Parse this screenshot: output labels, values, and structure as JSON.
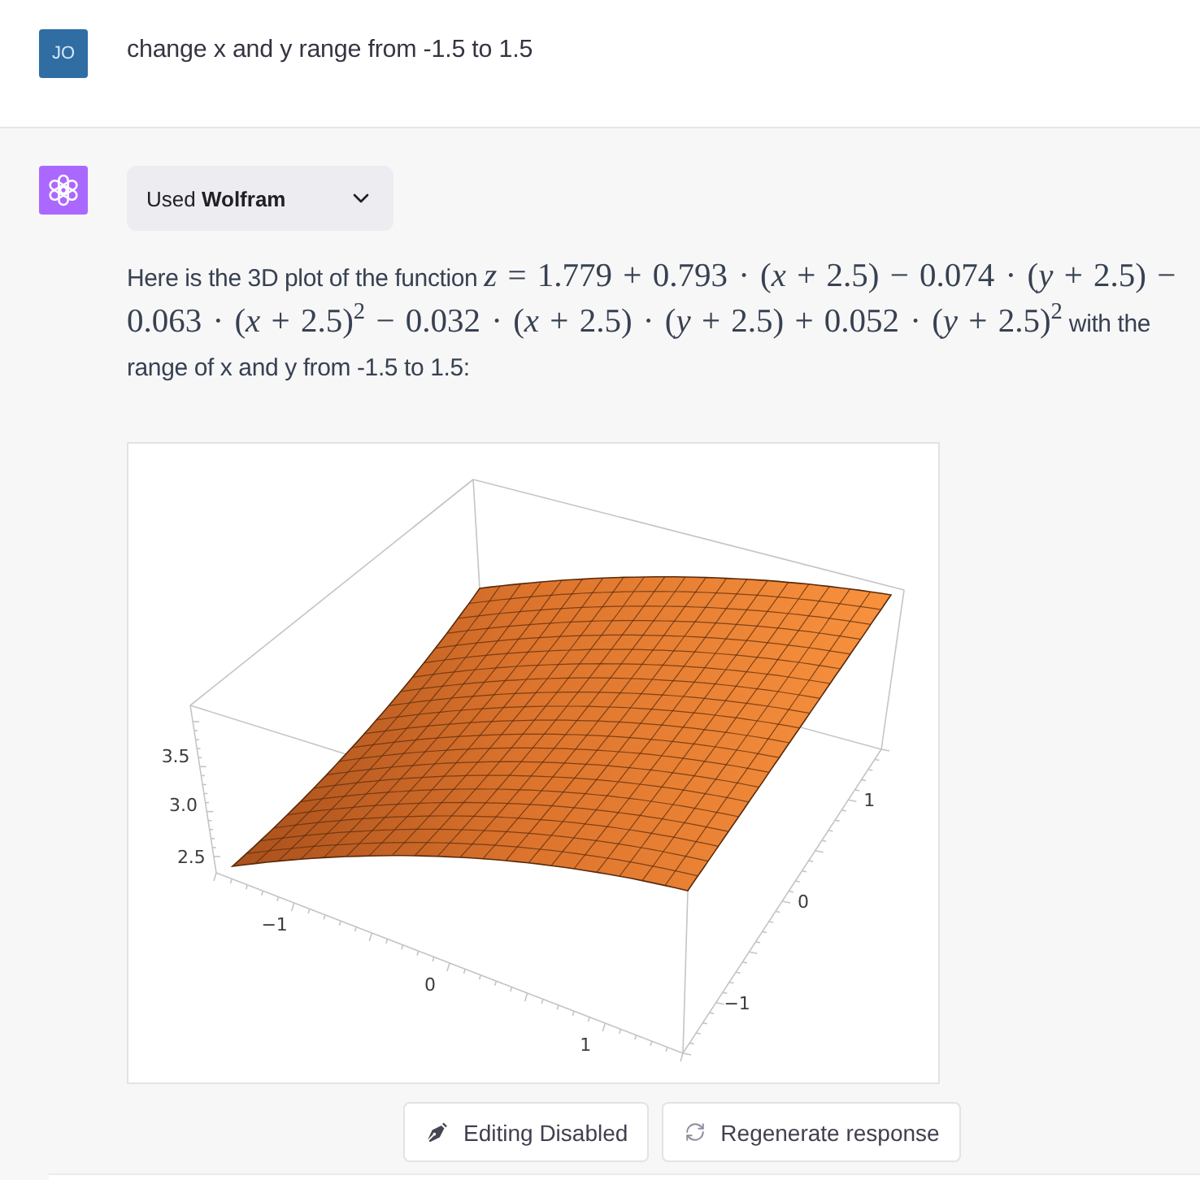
{
  "user_message": {
    "avatar": "JO",
    "text": "change x and y range from -1.5 to 1.5"
  },
  "assistant_message": {
    "plugin": {
      "label": "Used **Wolfram**",
      "expanded": false
    },
    "paragraph": [
      {
        "kind": "text",
        "text": "Here is the 3D plot of the function "
      },
      {
        "kind": "math",
        "text": "*z* = 1.779 + 0.793 · (*x* + 2.5) − 0.074 · (*y* + 2.5) − 0.063 · (*x* + 2.5)$^{2}$ − 0.032 · (*x* + 2.5) · (*y* + 2.5) + 0.052 · (*y* + 2.5)$^{2}$"
      },
      {
        "kind": "text",
        "text": " with the range of x and y from -1.5 to 1.5:"
      }
    ],
    "plot": {
      "z_ticks": [
        "3.5",
        "3.0",
        "2.5"
      ],
      "x_ticks": [
        "−1",
        "0",
        "1"
      ],
      "y_ticks": [
        "1",
        "0",
        "−1"
      ]
    }
  },
  "actions": [
    {
      "kind": "edit",
      "label": "Editing Disabled"
    },
    {
      "kind": "regenerate",
      "label": "Regenerate response"
    }
  ]
}
